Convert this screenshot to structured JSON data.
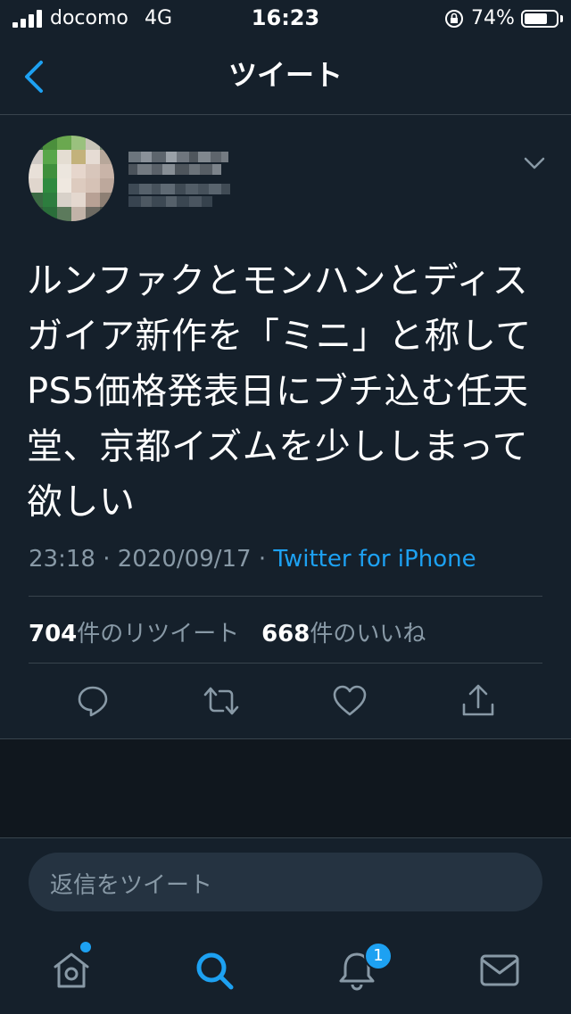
{
  "status_bar": {
    "carrier": "docomo",
    "network": "4G",
    "time": "16:23",
    "battery_percent": "74%",
    "battery_level": 0.74
  },
  "nav": {
    "title": "ツイート",
    "back_icon": "chevron-left-icon"
  },
  "tweet": {
    "text": "ルンファクとモンハンとディス\nガイア新作を「ミニ」と称して\nPS5価格発表日にブチ込む任天\n堂、京都イズムを少ししまって\n欲しい",
    "time": "23:18",
    "separator": "·",
    "date": "2020/09/17",
    "source": "Twitter for iPhone",
    "retweet_count": "704",
    "retweet_label": "件のリツイート",
    "like_count": "668",
    "like_label": "件のいいね"
  },
  "reply": {
    "placeholder": "返信をツイート"
  },
  "tabs": {
    "notification_badge": "1"
  },
  "colors": {
    "background": "#15202b",
    "accent": "#1da1f2",
    "muted": "#8899a6",
    "divider": "#38444d"
  }
}
